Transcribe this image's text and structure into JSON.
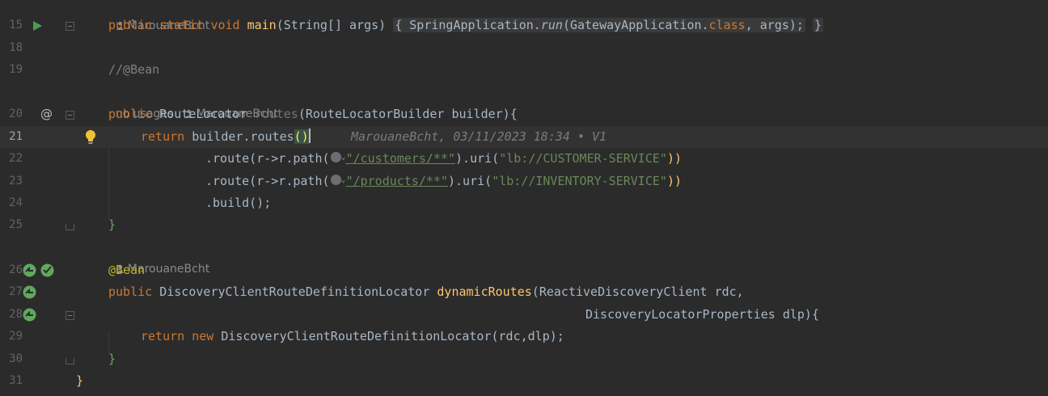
{
  "editor": {
    "lines": {
      "15": "15",
      "18": "18",
      "19": "19",
      "20": "20",
      "21": "21",
      "22": "22",
      "23": "23",
      "24": "24",
      "25": "25",
      "26": "26",
      "27": "27",
      "28": "28",
      "29": "29",
      "30": "30",
      "31": "31"
    },
    "author_hint_top": "MarouaneBcht",
    "no_usages": "no usages",
    "author_hint_routes": "MarouaneBcht",
    "author_hint_bean": "MarouaneBcht",
    "blame_inline": "MarouaneBcht, 03/11/2023 18:34 • V1",
    "code": {
      "l15_public": "public",
      "l15_static": "static",
      "l15_void": "void",
      "l15_main": "main",
      "l15_params": "(String[] args)",
      "l15_fold_body": "{ SpringApplication.",
      "l15_run": "run",
      "l15_rest1": "(GatewayApplication.",
      "l15_class": "class",
      "l15_rest2": ", args);",
      "l15_close": "}",
      "l19_comment": "//@Bean",
      "l20_public": "public",
      "l20_type": "RouteLocator",
      "l20_name": "routes",
      "l20_params": "(RouteLocatorBuilder builder){",
      "l21_return": "return",
      "l21_call": "builder.routes",
      "l21_parens": "()",
      "l22_route": ".route(r->r.path(",
      "l22_str": "\"/customers/**\"",
      "l22_uri": ").uri(",
      "l22_uristr": "\"lb://CUSTOMER-SERVICE\"",
      "l22_close": "))",
      "l23_route": ".route(r->r.path(",
      "l23_str": "\"/products/**\"",
      "l23_uri": ").uri(",
      "l23_uristr": "\"lb://INVENTORY-SERVICE\"",
      "l23_close": "))",
      "l24_build": ".build();",
      "l25_close": "}",
      "l26_ann": "@Bean",
      "l27_public": "public",
      "l27_type": "DiscoveryClientRouteDefinitionLocator",
      "l27_name": "dynamicRoutes",
      "l27_params": "(ReactiveDiscoveryClient rdc,",
      "l28_params": "DiscoveryLocatorProperties dlp){",
      "l29_return": "return",
      "l29_new": "new",
      "l29_rest": "DiscoveryClientRouteDefinitionLocator(rdc,dlp);",
      "l30_close": "}",
      "l31_close": "}"
    }
  },
  "icons": {
    "run": "run-arrow-icon",
    "at": "implemented-annotation-icon",
    "bulb": "intention-bulb-icon",
    "bean": "spring-bean-icon",
    "person": "person-icon",
    "globe": "web-url-icon"
  },
  "colors": {
    "background": "#2b2b2b",
    "keyword": "#cc7832",
    "method": "#ffc66d",
    "string": "#6a8759",
    "annotation": "#bbb529",
    "comment": "#808080"
  }
}
